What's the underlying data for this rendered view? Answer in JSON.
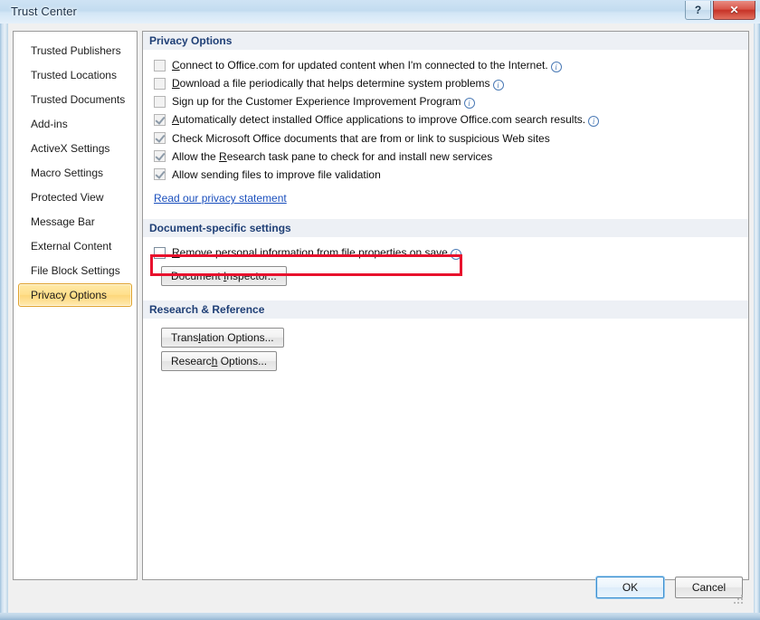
{
  "window": {
    "title": "Trust Center",
    "help_button_label": "?",
    "close_button_label": "✕"
  },
  "sidebar": {
    "items": [
      {
        "label": "Trusted Publishers",
        "selected": false
      },
      {
        "label": "Trusted Locations",
        "selected": false
      },
      {
        "label": "Trusted Documents",
        "selected": false
      },
      {
        "label": "Add-ins",
        "selected": false
      },
      {
        "label": "ActiveX Settings",
        "selected": false
      },
      {
        "label": "Macro Settings",
        "selected": false
      },
      {
        "label": "Protected View",
        "selected": false
      },
      {
        "label": "Message Bar",
        "selected": false
      },
      {
        "label": "External Content",
        "selected": false
      },
      {
        "label": "File Block Settings",
        "selected": false
      },
      {
        "label": "Privacy Options",
        "selected": true
      }
    ]
  },
  "sections": {
    "privacy_options": {
      "heading": "Privacy Options",
      "checkboxes": [
        {
          "pre": "",
          "accel": "C",
          "post": "onnect to Office.com for updated content when I'm connected to the Internet.",
          "checked": false,
          "info": true
        },
        {
          "pre": "",
          "accel": "D",
          "post": "ownload a file periodically that helps determine system problems",
          "checked": false,
          "info": true
        },
        {
          "pre": "Si",
          "accel": "g",
          "post": "n up for the Customer Experience Improvement Program",
          "checked": false,
          "info": true
        },
        {
          "pre": "",
          "accel": "A",
          "post": "utomatically detect installed Office applications to improve Office.com search results.",
          "checked": true,
          "info": true
        },
        {
          "pre": "Check Microsoft Office documents that are from or link to suspicious Web sites",
          "accel": "",
          "post": "",
          "checked": true,
          "info": false
        },
        {
          "pre": "Allow the ",
          "accel": "R",
          "post": "esearch task pane to check for and install new services",
          "checked": true,
          "info": false
        },
        {
          "pre": "Allow sending files to improve file validation",
          "accel": "",
          "post": "",
          "checked": true,
          "info": false
        }
      ],
      "privacy_link": "Read our privacy statement"
    },
    "document_specific": {
      "heading": "Document-specific settings",
      "checkbox": {
        "pre": "",
        "accel": "R",
        "post": "emove personal information from file properties on save",
        "checked": false,
        "info": true
      },
      "button": {
        "pre": "Document ",
        "accel": "I",
        "post": "nspector..."
      }
    },
    "research_reference": {
      "heading": "Research & Reference",
      "buttons": [
        {
          "pre": "Trans",
          "accel": "l",
          "post": "ation Options..."
        },
        {
          "pre": "Researc",
          "accel": "h",
          "post": " Options..."
        }
      ]
    }
  },
  "footer": {
    "ok_label": "OK",
    "cancel_label": "Cancel"
  },
  "colors": {
    "accent_selected": "#ffdf8c",
    "accent_selected_border": "#e0a32e",
    "section_heading_text": "#1f3f76",
    "link": "#1a4fbd",
    "highlight_annotation": "#e8112d",
    "close_button": "#c63327"
  }
}
